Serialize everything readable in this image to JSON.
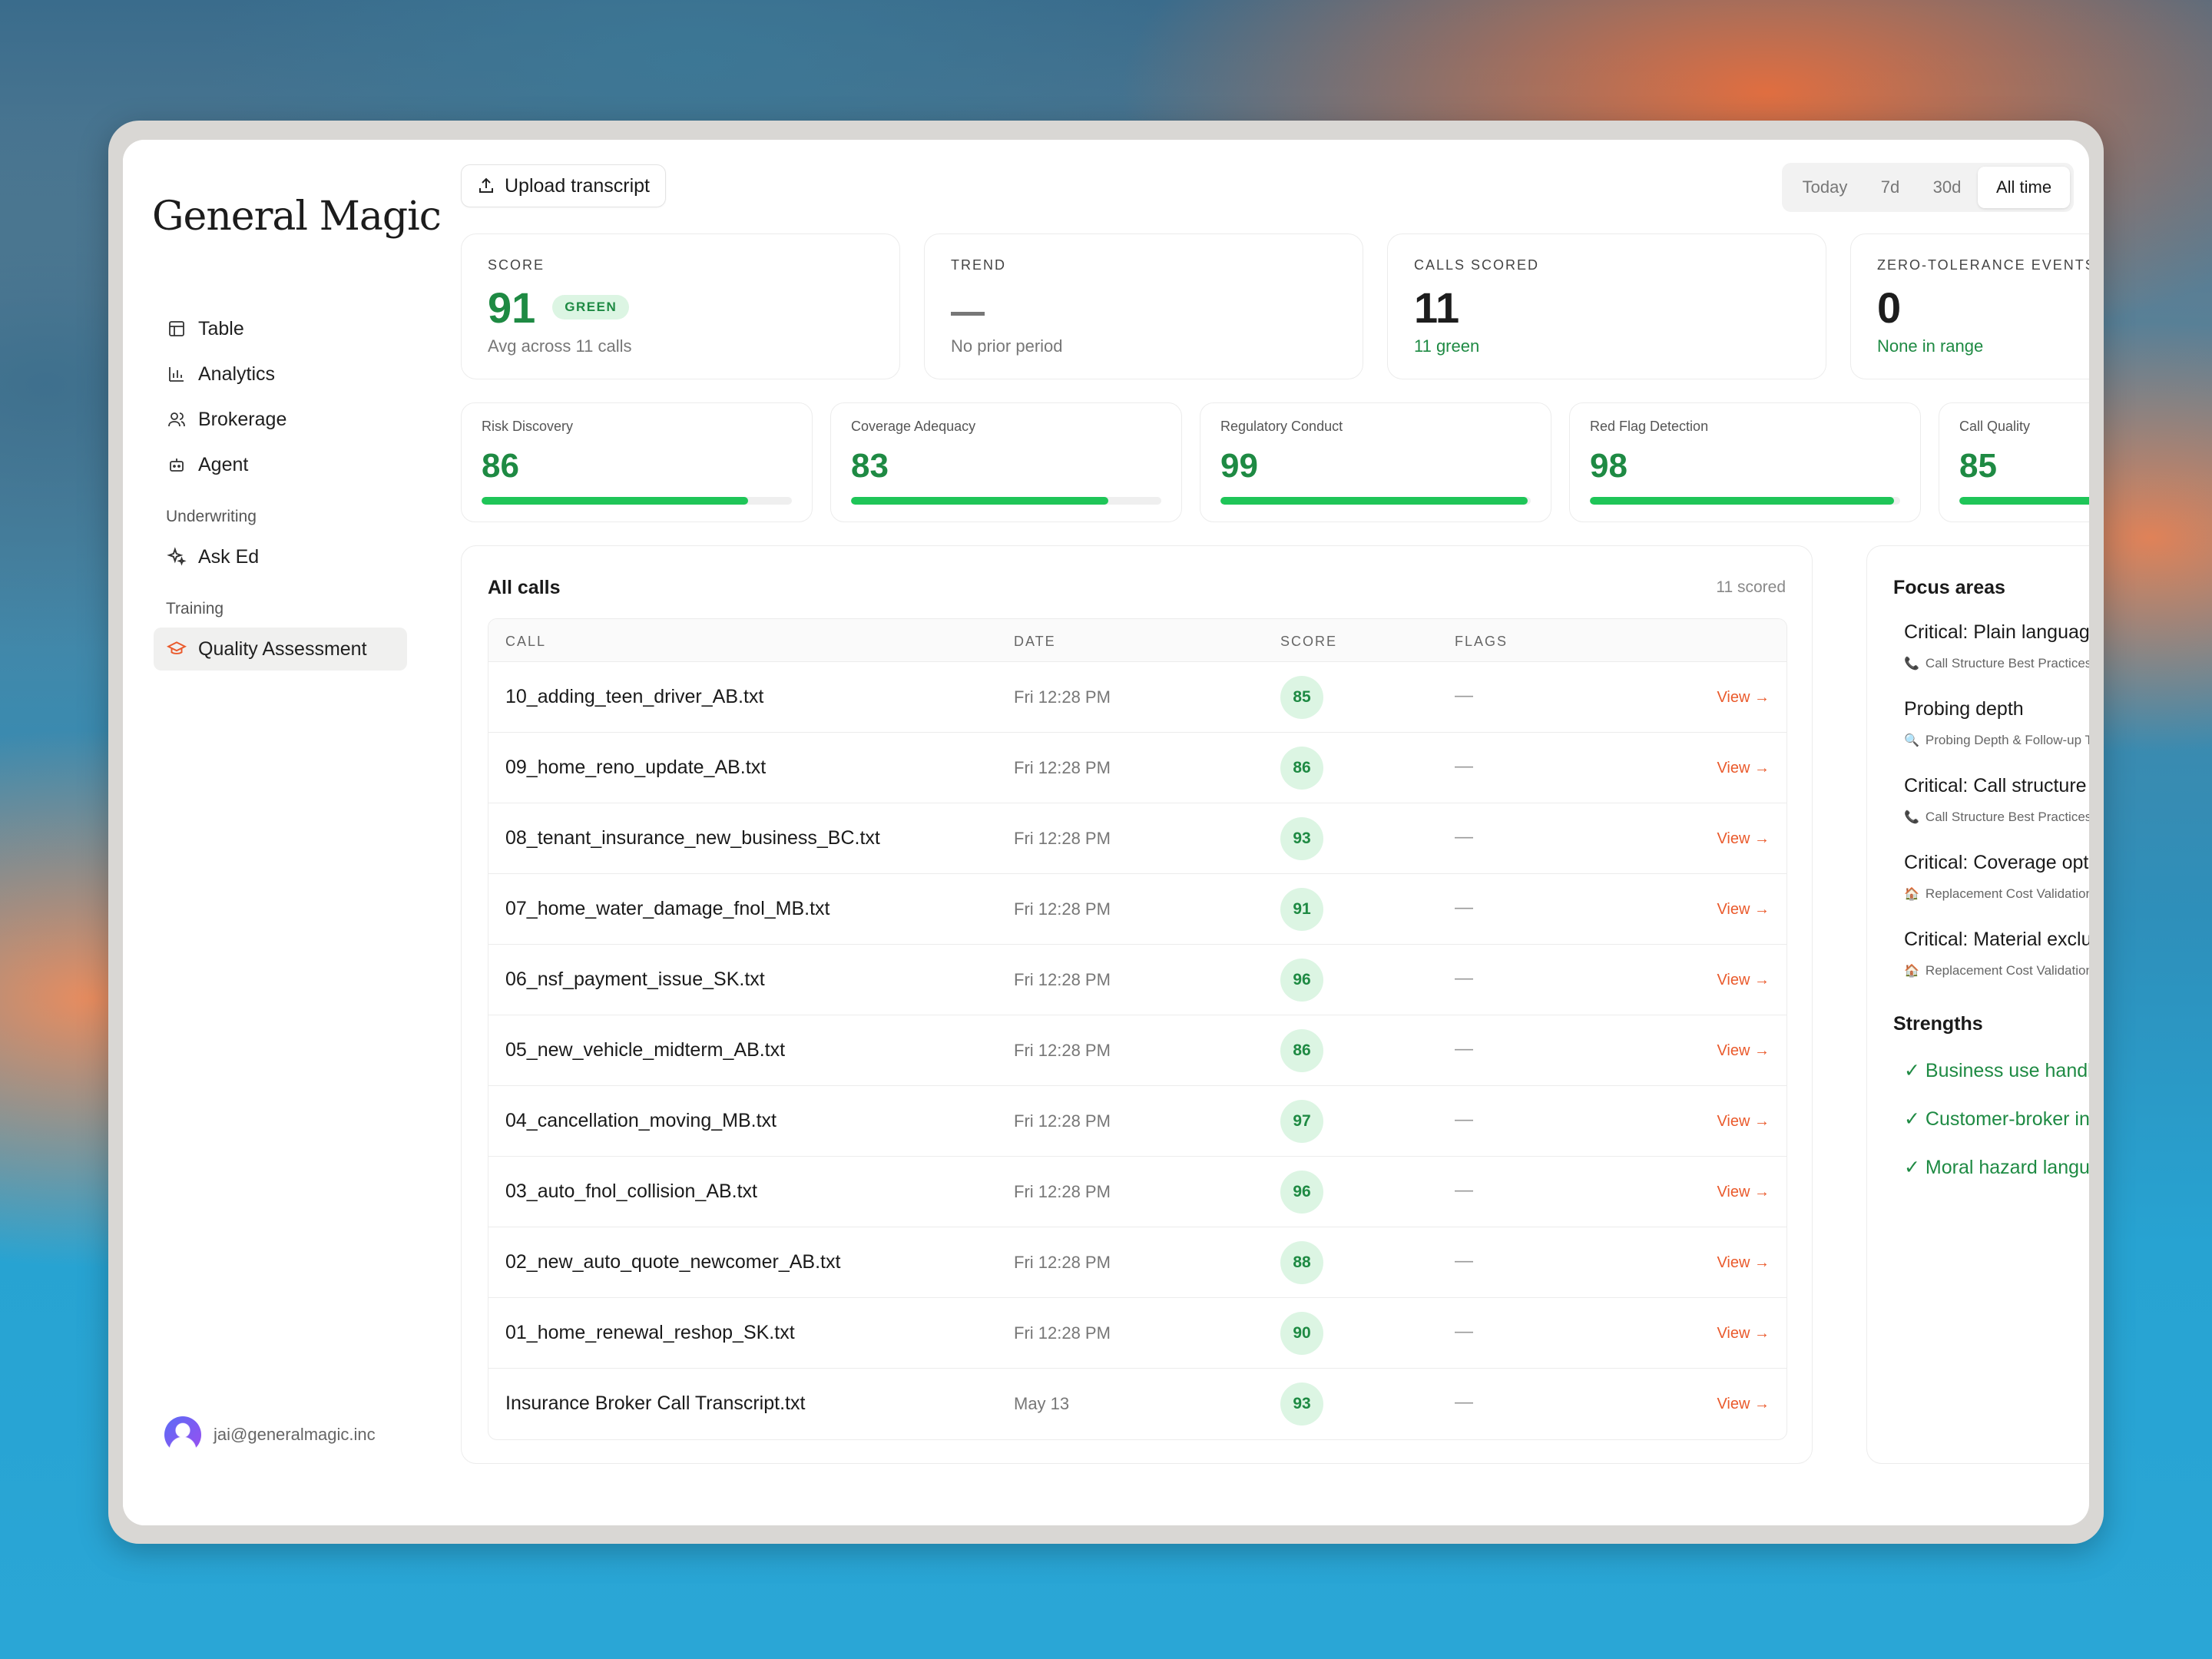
{
  "brand": "General Magic",
  "sidebar": {
    "items": [
      {
        "label": "Table",
        "icon": "table-icon"
      },
      {
        "label": "Analytics",
        "icon": "bar-chart-icon"
      },
      {
        "label": "Brokerage",
        "icon": "users-icon"
      },
      {
        "label": "Agent",
        "icon": "robot-icon"
      }
    ],
    "sections": [
      {
        "title": "Underwriting",
        "items": [
          {
            "label": "Ask Ed",
            "icon": "sparkle-icon"
          }
        ]
      },
      {
        "title": "Training",
        "items": [
          {
            "label": "Quality Assessment",
            "icon": "graduation-cap-icon",
            "active": true
          }
        ]
      }
    ],
    "user_email": "jai@generalmagic.inc"
  },
  "toolbar": {
    "upload_label": "Upload transcript",
    "ranges": [
      "Today",
      "7d",
      "30d",
      "All time"
    ],
    "active_range": "All time"
  },
  "stats": {
    "score": {
      "label": "SCORE",
      "value": "91",
      "badge": "GREEN",
      "sub": "Avg across 11 calls"
    },
    "trend": {
      "label": "TREND",
      "sub": "No prior period"
    },
    "calls": {
      "label": "CALLS SCORED",
      "value": "11",
      "sub": "11 green"
    },
    "zero": {
      "label": "ZERO-TOLERANCE EVENTS",
      "value": "0",
      "sub": "None in range"
    }
  },
  "metrics": [
    {
      "label": "Risk Discovery",
      "value": "86",
      "fill": 0.86
    },
    {
      "label": "Coverage Adequacy",
      "value": "83",
      "fill": 0.83
    },
    {
      "label": "Regulatory Conduct",
      "value": "99",
      "fill": 0.99
    },
    {
      "label": "Red Flag Detection",
      "value": "98",
      "fill": 0.98
    },
    {
      "label": "Call Quality",
      "value": "85",
      "fill": 0.85
    }
  ],
  "calls": {
    "title": "All calls",
    "count": "11 scored",
    "columns": {
      "call": "CALL",
      "date": "DATE",
      "score": "SCORE",
      "flags": "FLAGS"
    },
    "rows": [
      {
        "call": "10_adding_teen_driver_AB.txt",
        "date": "Fri 12:28 PM",
        "score": "85",
        "flags": "—",
        "action": "View →"
      },
      {
        "call": "09_home_reno_update_AB.txt",
        "date": "Fri 12:28 PM",
        "score": "86",
        "flags": "—",
        "action": "View →"
      },
      {
        "call": "08_tenant_insurance_new_business_BC.txt",
        "date": "Fri 12:28 PM",
        "score": "93",
        "flags": "—",
        "action": "View →"
      },
      {
        "call": "07_home_water_damage_fnol_MB.txt",
        "date": "Fri 12:28 PM",
        "score": "91",
        "flags": "—",
        "action": "View →"
      },
      {
        "call": "06_nsf_payment_issue_SK.txt",
        "date": "Fri 12:28 PM",
        "score": "96",
        "flags": "—",
        "action": "View →"
      },
      {
        "call": "05_new_vehicle_midterm_AB.txt",
        "date": "Fri 12:28 PM",
        "score": "86",
        "flags": "—",
        "action": "View →"
      },
      {
        "call": "04_cancellation_moving_MB.txt",
        "date": "Fri 12:28 PM",
        "score": "97",
        "flags": "—",
        "action": "View →"
      },
      {
        "call": "03_auto_fnol_collision_AB.txt",
        "date": "Fri 12:28 PM",
        "score": "96",
        "flags": "—",
        "action": "View →"
      },
      {
        "call": "02_new_auto_quote_newcomer_AB.txt",
        "date": "Fri 12:28 PM",
        "score": "88",
        "flags": "—",
        "action": "View →"
      },
      {
        "call": "01_home_renewal_reshop_SK.txt",
        "date": "Fri 12:28 PM",
        "score": "90",
        "flags": "—",
        "action": "View →"
      },
      {
        "call": "Insurance Broker Call Transcript.txt",
        "date": "May 13",
        "score": "93",
        "flags": "—",
        "action": "View →"
      }
    ]
  },
  "focus": {
    "title": "Focus areas",
    "items": [
      {
        "name": "Critical: Plain language c",
        "source": "Call Structure Best Practices",
        "emoji": "📞"
      },
      {
        "name": "Probing depth",
        "source": "Probing Depth & Follow-up Te",
        "emoji": "🔍"
      },
      {
        "name": "Critical: Call structure co",
        "source": "Call Structure Best Practices",
        "emoji": "📞"
      },
      {
        "name": "Critical: Coverage option",
        "source": "Replacement Cost Validation \\",
        "emoji": "🏠"
      },
      {
        "name": "Critical: Material exclusio",
        "source": "Replacement Cost Validation \\",
        "emoji": "🏠"
      }
    ],
    "strengths_title": "Strengths",
    "strengths": [
      "✓ Business use handling",
      "✓ Customer-broker incon",
      "✓ Moral hazard language"
    ]
  }
}
